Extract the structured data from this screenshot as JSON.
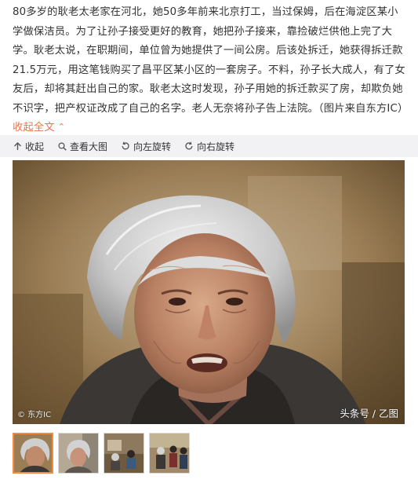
{
  "post": {
    "text": "80多岁的耿老太老家在河北，她50多年前来北京打工，当过保姆，后在海淀区某小学做保洁员。为了让孙子接受更好的教育，她把孙子接来，靠捡破烂供他上完了大学。耿老太说，在职期间，单位曾为她提供了一间公房。后该处拆迁，她获得拆迁款21.5万元，用这笔钱购买了昌平区某小区的一套房子。不料，孙子长大成人，有了女友后，却将其赶出自己的家。耿老太这时发现，孙子用她的拆迁款买了房，却欺负她不识字，把产权证改成了自己的名字。老人无奈将孙子告上法院。（图片来自东方IC）",
    "collapse_label": "收起全文",
    "collapse_icon": "chevron-up-icon",
    "accent_color": "#eb7350"
  },
  "toolbar": {
    "background": "#f2f2f5",
    "items": [
      {
        "label": "收起",
        "icon": "arrow-up-icon"
      },
      {
        "label": "查看大图",
        "icon": "magnifier-icon"
      },
      {
        "label": "向左旋转",
        "icon": "rotate-left-icon"
      },
      {
        "label": "向右旋转",
        "icon": "rotate-right-icon"
      }
    ]
  },
  "image": {
    "watermark_left": "© 东方IC",
    "watermark_right": "头条号 / 乙图"
  },
  "thumbnails": {
    "count": 4,
    "active_index": 0,
    "active_border_color": "#f58b3c"
  }
}
